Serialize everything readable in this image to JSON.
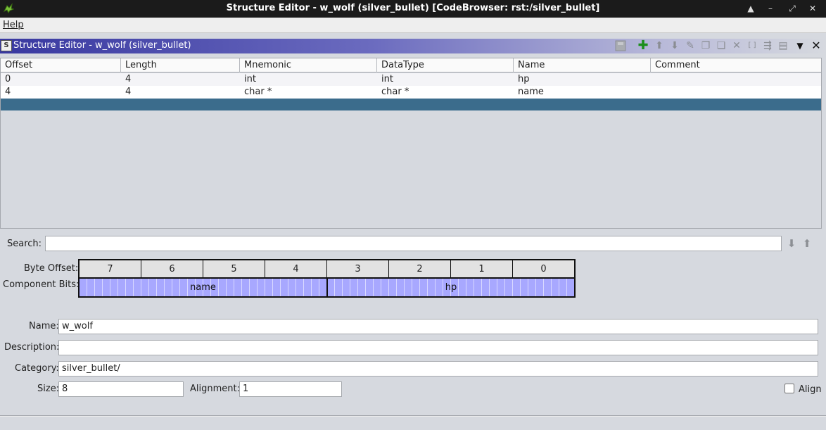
{
  "window": {
    "title": "Structure Editor - w_wolf (silver_bullet) [CodeBrowser: rst:/silver_bullet]",
    "controls": [
      "▲",
      "–",
      "⤢",
      "✕"
    ]
  },
  "menubar": {
    "help": "Help"
  },
  "panel": {
    "icon_text": "S",
    "title": "Structure Editor - w_wolf (silver_bullet)"
  },
  "table": {
    "columns": [
      "Offset",
      "Length",
      "Mnemonic",
      "DataType",
      "Name",
      "Comment"
    ],
    "rows": [
      [
        "0",
        "4",
        "int",
        "int",
        "hp",
        ""
      ],
      [
        "4",
        "4",
        "char *",
        "char *",
        "name",
        ""
      ]
    ]
  },
  "search": {
    "label": "Search:",
    "value": ""
  },
  "byte_view": {
    "offset_label": "Byte Offset:",
    "bits_label": "Component Bits:",
    "offsets": [
      "7",
      "6",
      "5",
      "4",
      "3",
      "2",
      "1",
      "0"
    ],
    "components": [
      "name",
      "hp"
    ]
  },
  "form": {
    "name_label": "Name:",
    "name_value": "w_wolf",
    "description_label": "Description:",
    "description_value": "",
    "category_label": "Category:",
    "category_value": "silver_bullet/",
    "size_label": "Size:",
    "size_value": "8",
    "alignment_label": "Alignment:",
    "alignment_value": "1",
    "align_label": "Align"
  },
  "colors": {
    "panel_title": "#3838a0",
    "selection": "#3b6c8c",
    "bits": "#a8a8ff",
    "add_icon": "#1b8f1b"
  }
}
